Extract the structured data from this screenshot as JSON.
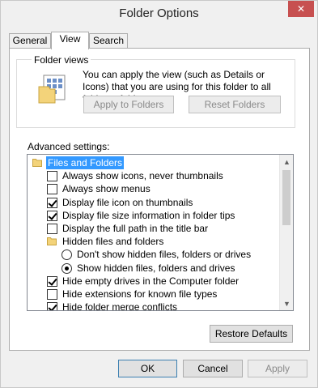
{
  "window": {
    "title": "Folder Options"
  },
  "tabs": [
    {
      "label": "General",
      "active": false
    },
    {
      "label": "View",
      "active": true
    },
    {
      "label": "Search",
      "active": false
    }
  ],
  "folder_views": {
    "group_label": "Folder views",
    "description": "You can apply the view (such as Details or Icons) that you are using for this folder to all folders of this type.",
    "apply_label": "Apply to Folders",
    "reset_label": "Reset Folders"
  },
  "advanced": {
    "label": "Advanced settings:",
    "items": [
      {
        "type": "folder",
        "label": "Files and Folders",
        "indent": 0,
        "selected": true
      },
      {
        "type": "checkbox",
        "label": "Always show icons, never thumbnails",
        "indent": 1,
        "checked": false
      },
      {
        "type": "checkbox",
        "label": "Always show menus",
        "indent": 1,
        "checked": false
      },
      {
        "type": "checkbox",
        "label": "Display file icon on thumbnails",
        "indent": 1,
        "checked": true
      },
      {
        "type": "checkbox",
        "label": "Display file size information in folder tips",
        "indent": 1,
        "checked": true
      },
      {
        "type": "checkbox",
        "label": "Display the full path in the title bar",
        "indent": 1,
        "checked": false
      },
      {
        "type": "folder",
        "label": "Hidden files and folders",
        "indent": 1,
        "selected": false
      },
      {
        "type": "radio",
        "label": "Don't show hidden files, folders or drives",
        "indent": 2,
        "checked": false
      },
      {
        "type": "radio",
        "label": "Show hidden files, folders and drives",
        "indent": 2,
        "checked": true
      },
      {
        "type": "checkbox",
        "label": "Hide empty drives in the Computer folder",
        "indent": 1,
        "checked": true
      },
      {
        "type": "checkbox",
        "label": "Hide extensions for known file types",
        "indent": 1,
        "checked": false
      },
      {
        "type": "checkbox",
        "label": "Hide folder merge conflicts",
        "indent": 1,
        "checked": true
      }
    ]
  },
  "buttons": {
    "restore_defaults": "Restore Defaults",
    "ok": "OK",
    "cancel": "Cancel",
    "apply": "Apply"
  },
  "icons": {
    "close": "close-icon",
    "folder": "folder-icon",
    "folder_views": "folder-views-icon",
    "scroll_up": "scroll-up-icon",
    "scroll_down": "scroll-down-icon"
  },
  "colors": {
    "selection": "#3399ff",
    "close_button": "#c75050",
    "window_bg": "#f0f0f0"
  }
}
